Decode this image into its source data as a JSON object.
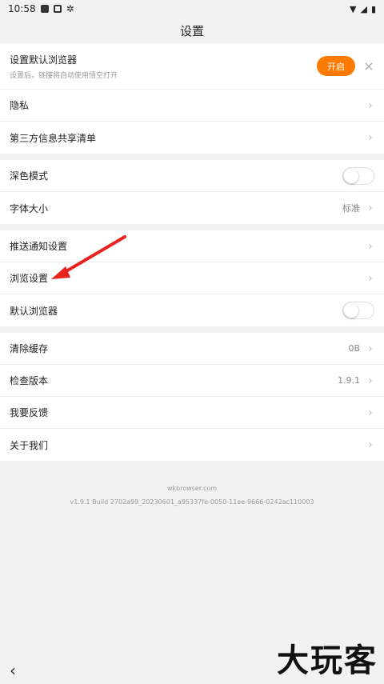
{
  "status": {
    "time": "10:58"
  },
  "header": {
    "title": "设置"
  },
  "banner": {
    "title": "设置默认浏览器",
    "subtitle": "设置后，链接将自动使用悟空打开",
    "button": "开启",
    "close": "×"
  },
  "groups": [
    {
      "rows": [
        {
          "label": "隐私"
        },
        {
          "label": "第三方信息共享清单"
        }
      ]
    },
    {
      "rows": [
        {
          "label": "深色模式"
        },
        {
          "label": "字体大小",
          "value": "标准"
        }
      ]
    },
    {
      "rows": [
        {
          "label": "推送通知设置"
        },
        {
          "label": "浏览设置"
        },
        {
          "label": "默认浏览器"
        }
      ]
    },
    {
      "rows": [
        {
          "label": "清除缓存",
          "value": "0B"
        },
        {
          "label": "检查版本",
          "value": "1.9.1"
        },
        {
          "label": "我要反馈"
        },
        {
          "label": "关于我们"
        }
      ]
    }
  ],
  "footer": {
    "domain": "wkbrowser.com",
    "build": "v1.9.1 Build 2702a99_20230601_a95337fe-0050-11ee-9666-0242ac110003"
  },
  "watermark": "大玩客",
  "colors": {
    "accent": "#ff7a00",
    "annotation_arrow": "#e8231d"
  },
  "icons": {
    "back": "chevron-left-icon",
    "row_arrow": "chevron-right-icon"
  }
}
